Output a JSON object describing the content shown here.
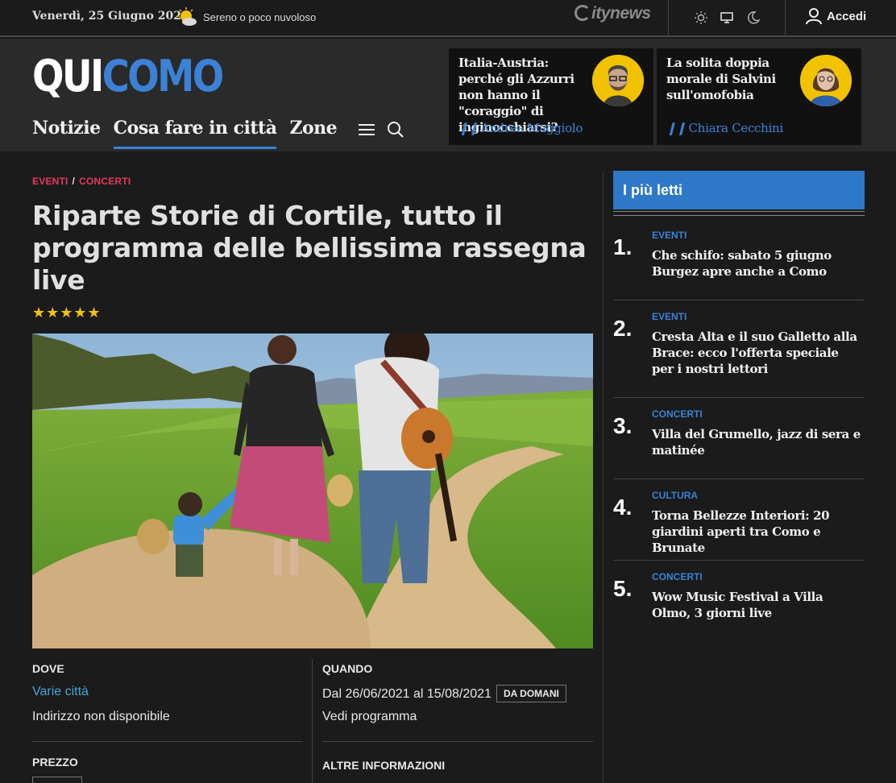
{
  "topbar": {
    "date": "Venerdì, 25 Giugno 2021",
    "weather": "Sereno o poco nuvoloso",
    "brand": "itynews",
    "login": "Accedi"
  },
  "header": {
    "logo_a": "QUI",
    "logo_b": "COMO",
    "nav": [
      "Notizie",
      "Cosa fare in città",
      "Zone"
    ],
    "active_nav": "Cosa fare in città",
    "opinions": [
      {
        "title": "Italia-Austria: perché gli Azzurri non hanno il \"coraggio\" di inginocchiarsi?",
        "author": "Andrea Maggiolo"
      },
      {
        "title": "La solita doppia morale di Salvini sull'omofobia",
        "author": "Chiara Cecchini"
      }
    ]
  },
  "article": {
    "crumb_1": "EVENTI",
    "crumb_sep": "/",
    "crumb_2": "CONCERTI",
    "title": "Riparte Storie di Cortile, tutto il programma delle bellissima rassegna live",
    "stars": "★★★★★",
    "rating": 5,
    "info": {
      "dove_label": "DOVE",
      "dove_value": "Varie città",
      "dove_address": "Indirizzo non disponibile",
      "quando_label": "QUANDO",
      "quando_value": "Dal 26/06/2021 al 15/08/2021",
      "quando_badge": "DA DOMANI",
      "quando_link": "Vedi programma",
      "prezzo_label": "PREZZO",
      "altre_label": "ALTRE INFORMAZIONI"
    }
  },
  "sidebar": {
    "title": "I più letti",
    "items": [
      {
        "num": "1.",
        "cat": "EVENTI",
        "title": "Che schifo: sabato 5 giugno Burgez apre anche a Como"
      },
      {
        "num": "2.",
        "cat": "EVENTI",
        "title": "Cresta Alta e il suo Galletto alla Brace: ecco l'offerta speciale per i nostri lettori"
      },
      {
        "num": "3.",
        "cat": "CONCERTI",
        "title": "Villa del Grumello, jazz di sera e matinée"
      },
      {
        "num": "4.",
        "cat": "CULTURA",
        "title": "Torna Bellezze Interiori: 20 giardini aperti tra Como e Brunate"
      },
      {
        "num": "5.",
        "cat": "CONCERTI",
        "title": "Wow Music Festival a Villa Olmo, 3 giorni live"
      }
    ]
  },
  "colors": {
    "accent": "#3b82d6",
    "category_red": "#e8375f",
    "star": "#f4c20d",
    "background": "#1b1b1b"
  }
}
